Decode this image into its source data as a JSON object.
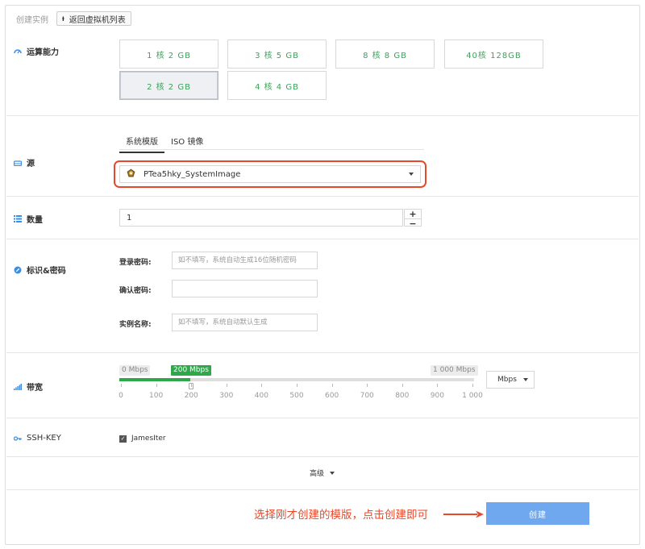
{
  "header": {
    "crumb": "创建实例",
    "back_icon": "back-arrow-icon",
    "back_label": "返回虚拟机列表"
  },
  "compute": {
    "label": "运算能力",
    "specs": [
      "1 核 2 GB",
      "3 核 5 GB",
      "8 核 8 GB",
      "40核 128GB",
      "2 核 2 GB",
      "4 核 4 GB"
    ],
    "selected": "2 核 2 GB"
  },
  "source": {
    "label": "源",
    "tabs": [
      "系统模版",
      "ISO 镜像"
    ],
    "active_tab": "系统模版",
    "selected_image": "PTea5hky_SystemImage"
  },
  "quantity": {
    "label": "数量",
    "value": "1",
    "inc": "+",
    "dec": "−"
  },
  "identity": {
    "label": "标识&密码",
    "password_label": "登录密码:",
    "password_placeholder": "如不填写，系统自动生成16位随机密码",
    "confirm_label": "确认密码:",
    "confirm_value": "",
    "name_label": "实例名称:",
    "name_placeholder": "如不填写，系统自动默认生成"
  },
  "bandwidth": {
    "label": "带宽",
    "min_label": "0 Mbps",
    "max_label": "1 000 Mbps",
    "current_label": "200 Mbps",
    "value": 200,
    "min": 0,
    "max": 1000,
    "ticks": [
      "0",
      "100",
      "200",
      "300",
      "400",
      "500",
      "600",
      "700",
      "800",
      "900",
      "1 000"
    ],
    "unit": "Mbps"
  },
  "ssh": {
    "label": "SSH-KEY",
    "key_name": "JamesIter",
    "checked": true
  },
  "advanced_label": "高级",
  "annotation": "选择刚才创建的模版，点击创建即可",
  "create_label": "创建",
  "colors": {
    "accent_green": "#2ea84a",
    "spec_text": "#3aa35a",
    "highlight_red": "#e8482a",
    "primary_blue": "#6fa8ef"
  }
}
